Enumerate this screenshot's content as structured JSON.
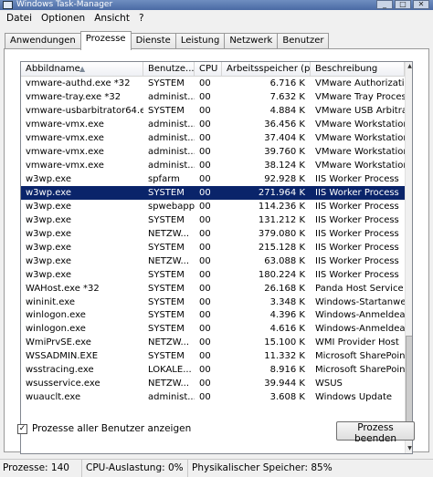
{
  "window": {
    "title": "Windows Task-Manager"
  },
  "menu": [
    "Datei",
    "Optionen",
    "Ansicht",
    "?"
  ],
  "tabs": [
    "Anwendungen",
    "Prozesse",
    "Dienste",
    "Leistung",
    "Netzwerk",
    "Benutzer"
  ],
  "active_tab": "Prozesse",
  "columns": {
    "name": "Abbildname",
    "user": "Benutze...",
    "cpu": "CPU",
    "memory": "Arbeitsspeicher (p...",
    "description": "Beschreibung"
  },
  "rows": [
    {
      "name": "vmware-authd.exe *32",
      "user": "SYSTEM",
      "cpu": "00",
      "mem": "6.716 K",
      "desc": "VMware Authorization"
    },
    {
      "name": "vmware-tray.exe *32",
      "user": "administ...",
      "cpu": "00",
      "mem": "7.632 K",
      "desc": "VMware Tray Process"
    },
    {
      "name": "vmware-usbarbitrator64.exe",
      "user": "SYSTEM",
      "cpu": "00",
      "mem": "4.884 K",
      "desc": "VMware USB Arbitration"
    },
    {
      "name": "vmware-vmx.exe",
      "user": "administ...",
      "cpu": "00",
      "mem": "36.456 K",
      "desc": "VMware Workstation VM"
    },
    {
      "name": "vmware-vmx.exe",
      "user": "administ...",
      "cpu": "00",
      "mem": "37.404 K",
      "desc": "VMware Workstation VM"
    },
    {
      "name": "vmware-vmx.exe",
      "user": "administ...",
      "cpu": "00",
      "mem": "39.760 K",
      "desc": "VMware Workstation VM"
    },
    {
      "name": "vmware-vmx.exe",
      "user": "administ...",
      "cpu": "00",
      "mem": "38.124 K",
      "desc": "VMware Workstation VM"
    },
    {
      "name": "w3wp.exe",
      "user": "spfarm",
      "cpu": "00",
      "mem": "92.928 K",
      "desc": "IIS Worker Process"
    },
    {
      "name": "w3wp.exe",
      "user": "SYSTEM",
      "cpu": "00",
      "mem": "271.964 K",
      "desc": "IIS Worker Process",
      "selected": true
    },
    {
      "name": "w3wp.exe",
      "user": "spwebapp",
      "cpu": "00",
      "mem": "114.236 K",
      "desc": "IIS Worker Process"
    },
    {
      "name": "w3wp.exe",
      "user": "SYSTEM",
      "cpu": "00",
      "mem": "131.212 K",
      "desc": "IIS Worker Process"
    },
    {
      "name": "w3wp.exe",
      "user": "NETZW...",
      "cpu": "00",
      "mem": "379.080 K",
      "desc": "IIS Worker Process"
    },
    {
      "name": "w3wp.exe",
      "user": "SYSTEM",
      "cpu": "00",
      "mem": "215.128 K",
      "desc": "IIS Worker Process"
    },
    {
      "name": "w3wp.exe",
      "user": "NETZW...",
      "cpu": "00",
      "mem": "63.088 K",
      "desc": "IIS Worker Process"
    },
    {
      "name": "w3wp.exe",
      "user": "SYSTEM",
      "cpu": "00",
      "mem": "180.224 K",
      "desc": "IIS Worker Process"
    },
    {
      "name": "WAHost.exe *32",
      "user": "SYSTEM",
      "cpu": "00",
      "mem": "26.168 K",
      "desc": "Panda Host Service"
    },
    {
      "name": "wininit.exe",
      "user": "SYSTEM",
      "cpu": "00",
      "mem": "3.348 K",
      "desc": "Windows-Startanwendung"
    },
    {
      "name": "winlogon.exe",
      "user": "SYSTEM",
      "cpu": "00",
      "mem": "4.396 K",
      "desc": "Windows-Anmeldeanwendung"
    },
    {
      "name": "winlogon.exe",
      "user": "SYSTEM",
      "cpu": "00",
      "mem": "4.616 K",
      "desc": "Windows-Anmeldeanwendung"
    },
    {
      "name": "WmiPrvSE.exe",
      "user": "NETZW...",
      "cpu": "00",
      "mem": "15.100 K",
      "desc": "WMI Provider Host"
    },
    {
      "name": "WSSADMIN.EXE",
      "user": "SYSTEM",
      "cpu": "00",
      "mem": "11.332 K",
      "desc": "Microsoft SharePoint Foundation"
    },
    {
      "name": "wsstracing.exe",
      "user": "LOKALE...",
      "cpu": "00",
      "mem": "8.916 K",
      "desc": "Microsoft SharePoint Foundation"
    },
    {
      "name": "wsusservice.exe",
      "user": "NETZW...",
      "cpu": "00",
      "mem": "39.944 K",
      "desc": "WSUS"
    },
    {
      "name": "wuauclt.exe",
      "user": "administ...",
      "cpu": "00",
      "mem": "3.608 K",
      "desc": "Windows Update"
    }
  ],
  "checkbox": {
    "label": "Prozesse aller Benutzer anzeigen",
    "checked": true
  },
  "end_button": "Prozess beenden",
  "status": {
    "processes": "Prozesse: 140",
    "cpu": "CPU-Auslastung: 0%",
    "memory": "Physikalischer Speicher: 85%"
  },
  "colors": {
    "selection": "#0a246a",
    "titlebar": "#5a79b2"
  }
}
